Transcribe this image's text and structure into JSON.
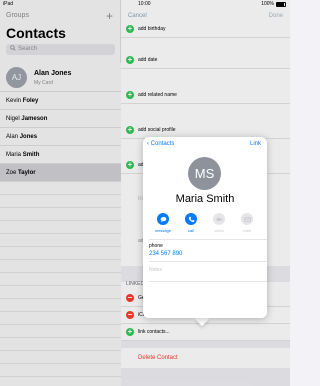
{
  "status": {
    "carrier": "iPad",
    "time": "10:00",
    "battery": "100%"
  },
  "left": {
    "groups_label": "Groups",
    "add_label": "+",
    "title": "Contacts",
    "search_placeholder": "Search",
    "my_card": {
      "initials": "AJ",
      "name": "Alan Jones",
      "subtitle": "My Card"
    },
    "contacts": [
      {
        "first": "Kevin",
        "last": "Foley"
      },
      {
        "first": "Nigel",
        "last": "Jameson"
      },
      {
        "first": "Alan",
        "last": "Jones"
      },
      {
        "first": "Maria",
        "last": "Smith"
      },
      {
        "first": "Zoe",
        "last": "Taylor"
      }
    ]
  },
  "right": {
    "cancel_label": "Cancel",
    "done_label": "Done",
    "fields": [
      "add birthday",
      "add date",
      "add related name",
      "add social profile",
      "ad"
    ],
    "linked_header": "LINKED",
    "linked_items": [
      "Ge",
      "iCl"
    ],
    "link_contacts_label": "link contacts...",
    "delete_label": "Delete Contact",
    "faded": [
      "Ri",
      "ad"
    ]
  },
  "popover": {
    "back_label": "Contacts",
    "link_label": "Link",
    "initials": "MS",
    "name": "Maria Smith",
    "actions": [
      {
        "label": "message",
        "icon": "message-icon",
        "enabled": true
      },
      {
        "label": "call",
        "icon": "phone-icon",
        "enabled": true
      },
      {
        "label": "video",
        "icon": "video-icon",
        "enabled": false
      },
      {
        "label": "mail",
        "icon": "mail-icon",
        "enabled": false
      }
    ],
    "phone_label": "phone",
    "phone_value": "234 567 890",
    "notes_label": "Notes"
  },
  "colors": {
    "accent": "#007aff",
    "add": "#34c759",
    "remove": "#ff3b30"
  }
}
